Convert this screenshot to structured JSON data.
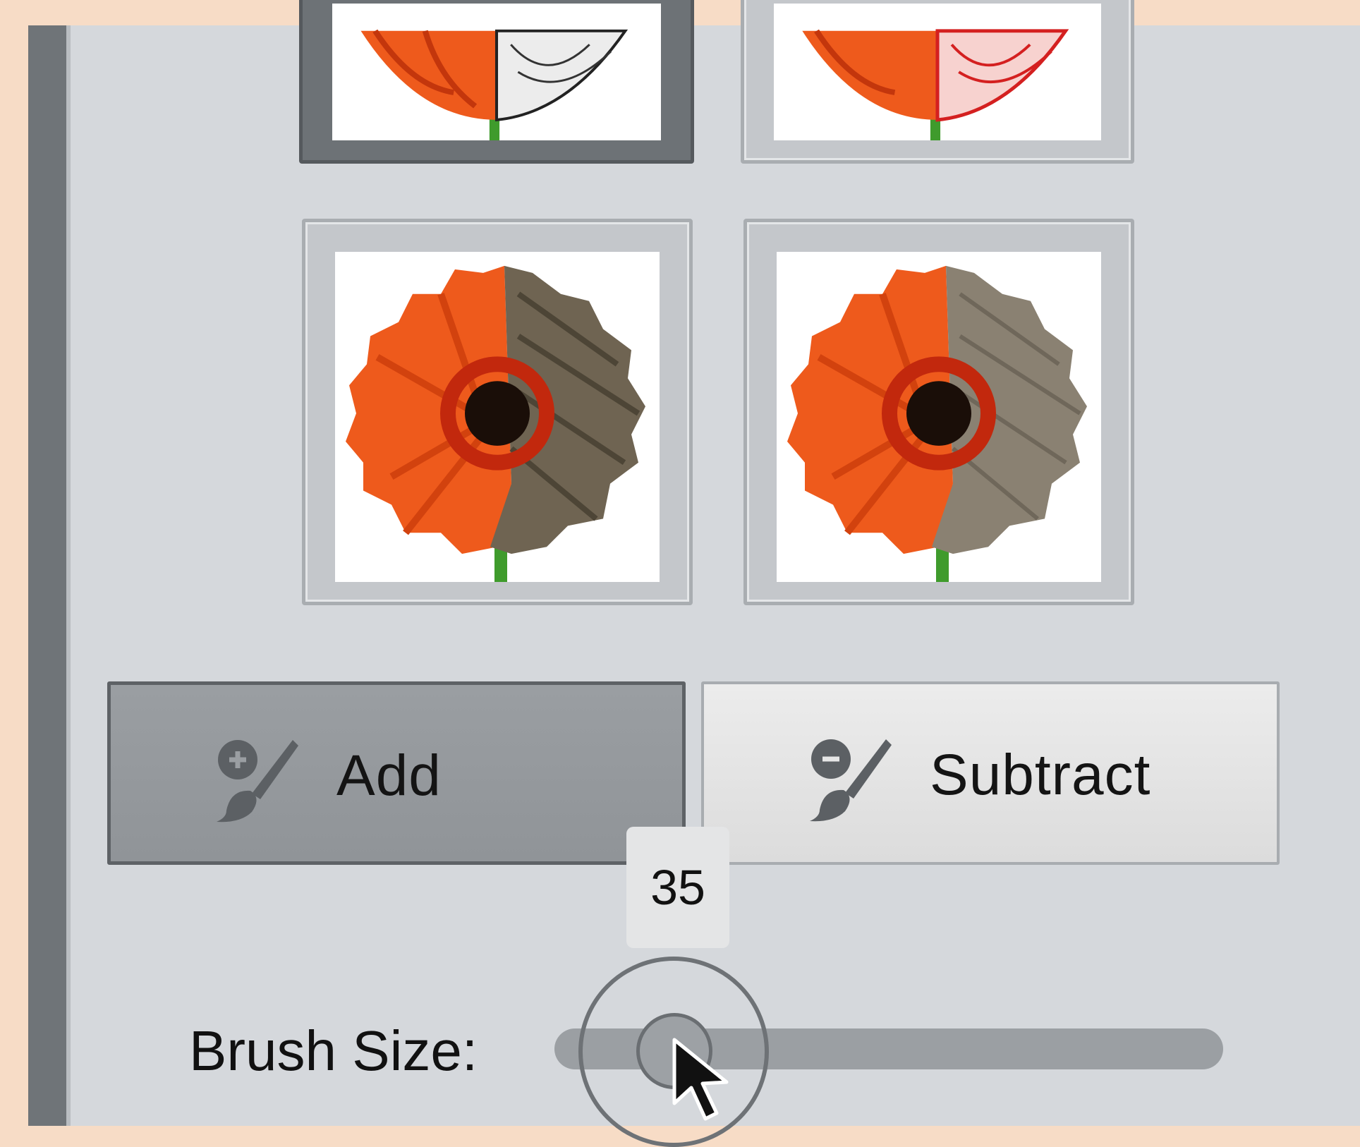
{
  "thumbnails": [
    {
      "name": "sketch-effect",
      "selected": true
    },
    {
      "name": "red-outline-effect",
      "selected": false
    },
    {
      "name": "sepia-texture-effect",
      "selected": false
    },
    {
      "name": "sepia-smooth-effect",
      "selected": false
    }
  ],
  "buttons": {
    "add_label": "Add",
    "add_icon": "brush-add-icon",
    "subtract_label": "Subtract",
    "subtract_icon": "brush-subtract-icon"
  },
  "brush": {
    "label": "Brush Size:",
    "value": "35"
  },
  "colors": {
    "background": "#f7dcc6",
    "panel": "#d5d8dc",
    "flower": "#ee5a1c",
    "sepia": "#7a7263"
  }
}
